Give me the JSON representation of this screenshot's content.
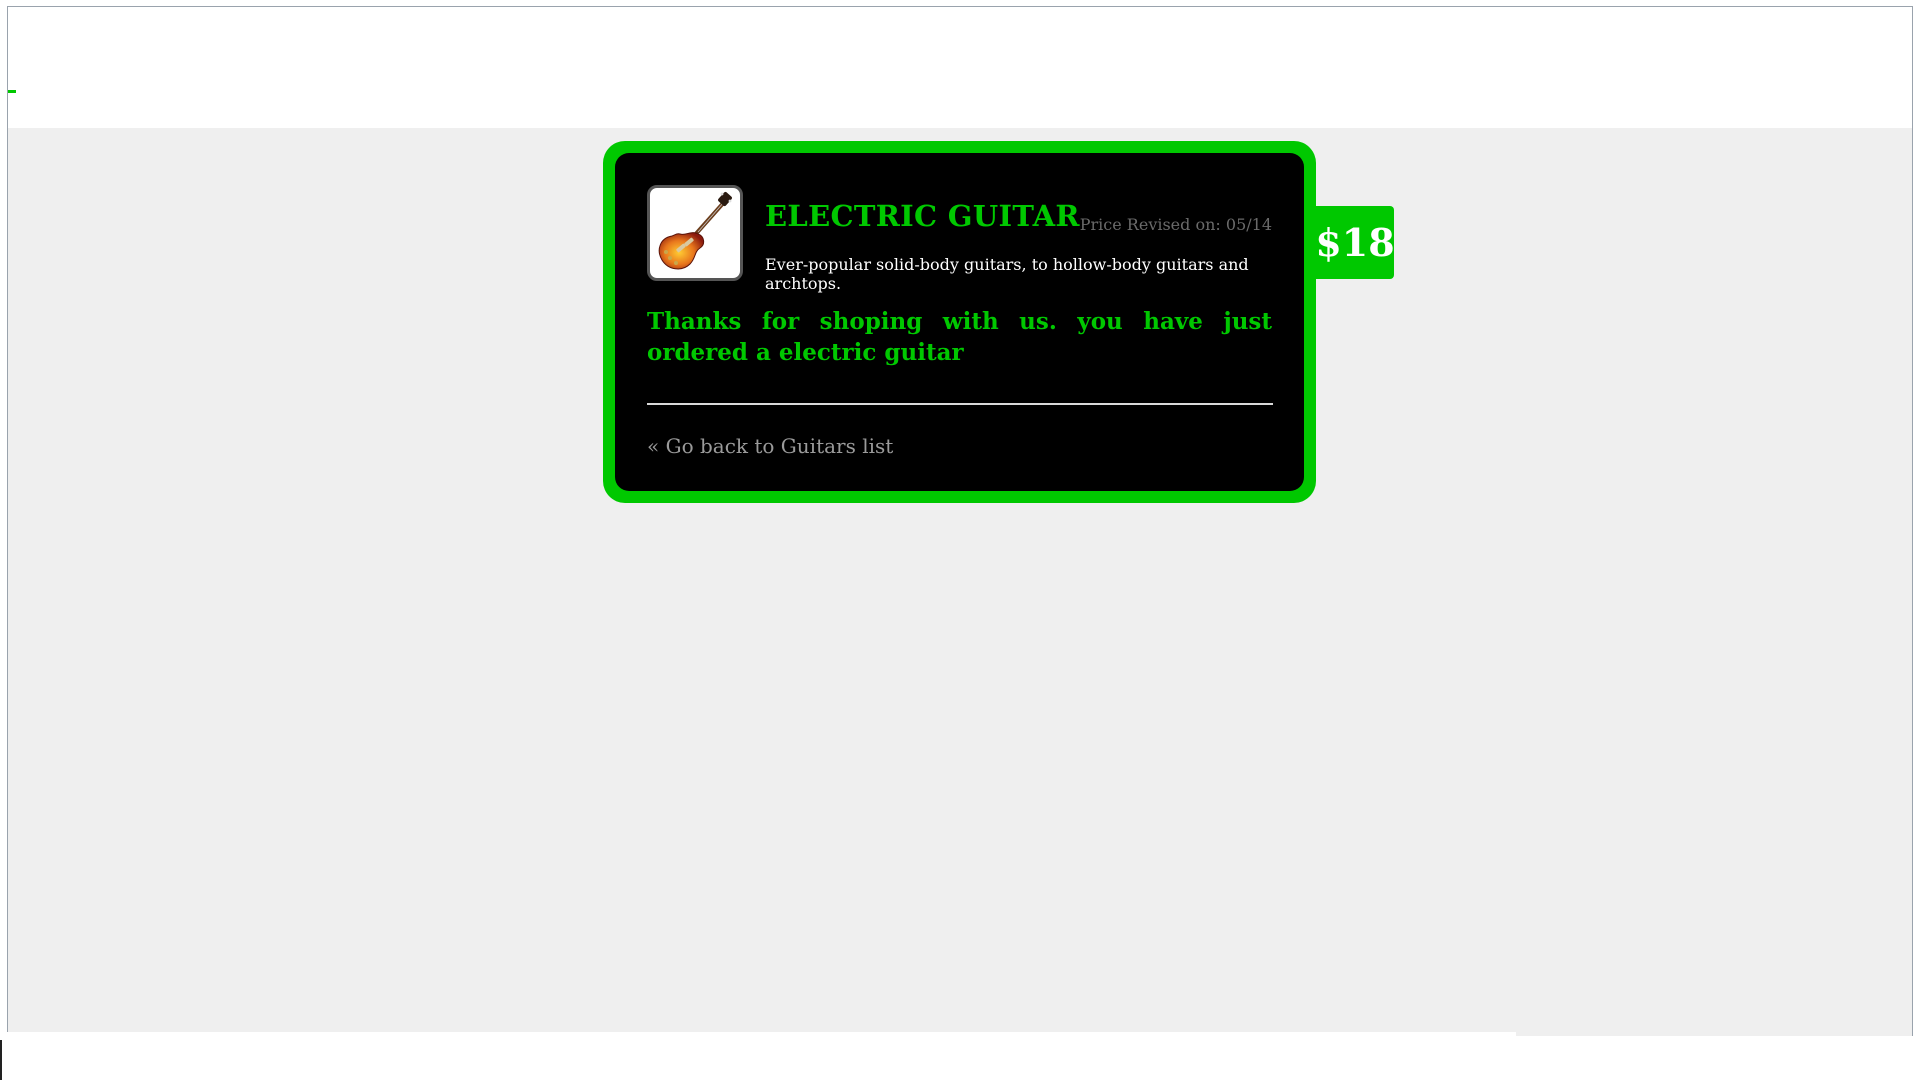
{
  "product": {
    "title": "ELECTRIC GUITAR",
    "price_revised": "Price Revised on: 05/14",
    "description": "Ever-popular solid-body guitars, to hollow-body guitars and archtops.",
    "price": "$18",
    "image_icon": "electric-guitar-icon"
  },
  "order": {
    "message": "Thanks for shoping with us. you have just ordered a electric guitar"
  },
  "nav": {
    "back_link": "« Go back to Guitars list"
  },
  "colors": {
    "accent": "#00c800",
    "card_background": "#000000",
    "page_background": "#efefef",
    "muted_text": "#6a6a6a"
  }
}
